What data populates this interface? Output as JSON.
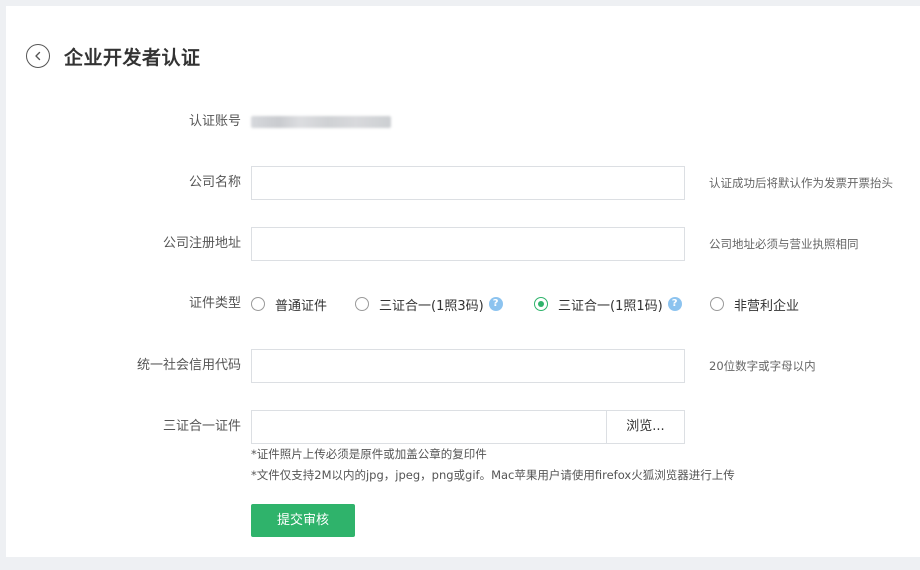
{
  "page": {
    "title": "企业开发者认证"
  },
  "form": {
    "account": {
      "label": "认证账号"
    },
    "company_name": {
      "label": "公司名称",
      "value": "",
      "hint": "认证成功后将默认作为发票开票抬头"
    },
    "company_address": {
      "label": "公司注册地址",
      "value": "",
      "hint": "公司地址必须与营业执照相同"
    },
    "cert_type": {
      "label": "证件类型",
      "selected": "三证合一(1照1码)",
      "options": [
        {
          "label": "普通证件",
          "checked": false,
          "help": false
        },
        {
          "label": "三证合一(1照3码)",
          "checked": false,
          "help": true
        },
        {
          "label": "三证合一(1照1码)",
          "checked": true,
          "help": true
        },
        {
          "label": "非营利企业",
          "checked": false,
          "help": false
        }
      ],
      "help_glyph": "?"
    },
    "credit_code": {
      "label": "统一社会信用代码",
      "value": "",
      "hint": "20位数字或字母以内"
    },
    "certificate": {
      "label": "三证合一证件",
      "browse_label": "浏览...",
      "notes": [
        "*证件照片上传必须是原件或加盖公章的复印件",
        "*文件仅支持2M以内的jpg，jpeg，png或gif。Mac苹果用户请使用firefox火狐浏览器进行上传"
      ]
    },
    "submit_label": "提交审核"
  },
  "icons": {
    "back": "chevron-left-icon",
    "help": "question-circle-icon"
  },
  "colors": {
    "accent": "#2fb36b",
    "help_icon": "#8cc3ef",
    "border": "#dcdfe3",
    "background": "#eef0f3"
  }
}
